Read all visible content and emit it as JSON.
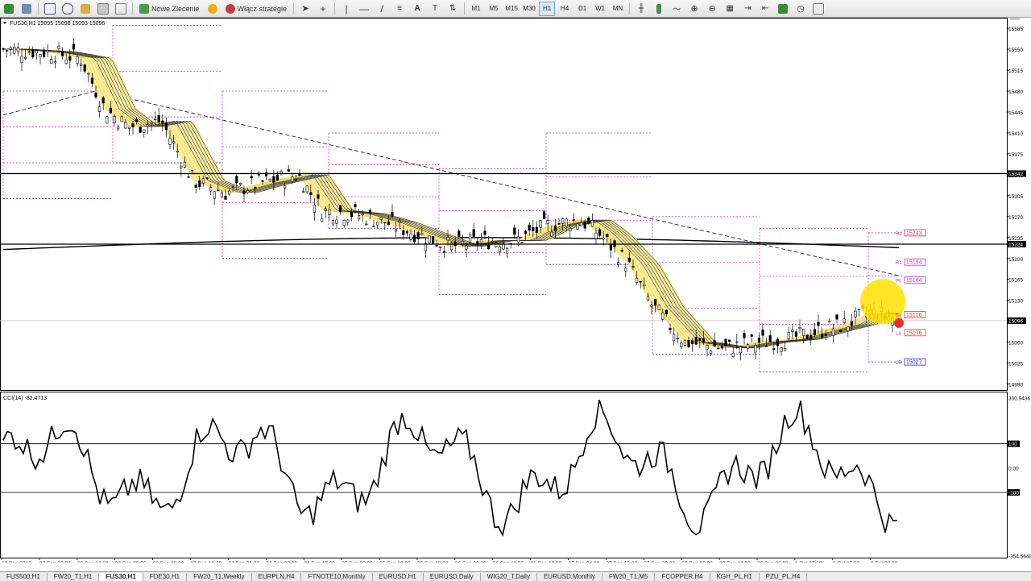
{
  "toolbar": {
    "new_order_label": "Nowe Zlecenie",
    "strategies_label": "Włącz strategie",
    "timeframes": [
      "M1",
      "M5",
      "M15",
      "M30",
      "H1",
      "H4",
      "D1",
      "W1",
      "MN"
    ],
    "active_timeframe": "H1"
  },
  "main_chart": {
    "header": "FUS30,H1  15095 15098 15093 15096",
    "price_labels": [
      "15585",
      "15550",
      "15515",
      "15480",
      "15445",
      "15410",
      "15375",
      "15340",
      "15305",
      "15270",
      "15235",
      "15200",
      "15165",
      "15130",
      "15096",
      "15060",
      "15025",
      "14990"
    ],
    "highlighted_prices": {
      "resistance_top": "15342",
      "resistance_mid": "15224",
      "current": "15096"
    },
    "pivots": [
      {
        "tag": "R2",
        "value": "15243",
        "color": "#e0306a"
      },
      {
        "tag": "R1",
        "value": "15194",
        "color": "#d030d0"
      },
      {
        "tag": "P0",
        "value": "15164",
        "color": "#d030d0"
      },
      {
        "tag": "S1",
        "value": "15106",
        "color": "#e04040"
      },
      {
        "tag": "L4",
        "value": "15076",
        "color": "#e04040"
      },
      {
        "tag": "L5",
        "value": "15027",
        "color": "#3030d0"
      }
    ]
  },
  "indicator": {
    "header": "CCI(14) -82.4713",
    "scale_labels": [
      "300.9436",
      "100",
      "0.00",
      "-100",
      "-354.5648"
    ]
  },
  "time_axis": [
    "19 Sep 2013",
    "20 Sep 06:00",
    "20 Sep 14:00",
    "23 Sep 00:00",
    "23 Sep 08:00",
    "23 Sep 16:00",
    "24 Sep 01:00",
    "24 Sep 09:00",
    "24 Sep 17:00",
    "25 Sep 02:00",
    "25 Sep 10:00",
    "25 Sep 18:00",
    "26 Sep 03:00",
    "26 Sep 11:00",
    "26 Sep 19:00",
    "27 Sep 04:00",
    "27 Sep 12:00",
    "27 Sep 20:00",
    "30 Sep 06:00",
    "30 Sep 14:00",
    "30 Sep 22:00",
    "1 Oct 07:00",
    "1 Oct 15:00",
    "2 Oct 00:00"
  ],
  "tabs": [
    "FUS500,H1",
    "FW20_T1,H1",
    "FUS30,H1",
    "FDE30,H1",
    "FW20_T1,Weekly",
    "EURPLN,H4",
    "FTNOTE10,Monthly",
    "EURUSD,H1",
    "EURUSD,Daily",
    "WIG20_T,Daily",
    "EURUSD,Monthly",
    "FW20_T1,M5",
    "FCOPPER,H4",
    "KGH_PL,H1",
    "PZU_PL,H4"
  ],
  "active_tab": "FUS30,H1",
  "colors": {
    "bull_band": "#f3d34a",
    "band_light": "#fbeea0",
    "candle": "#000000",
    "ema_slow": "#000000",
    "ma_dashed": "#2a2a8a",
    "pivot_box": "#d040d0",
    "sun": "#ffe000"
  }
}
